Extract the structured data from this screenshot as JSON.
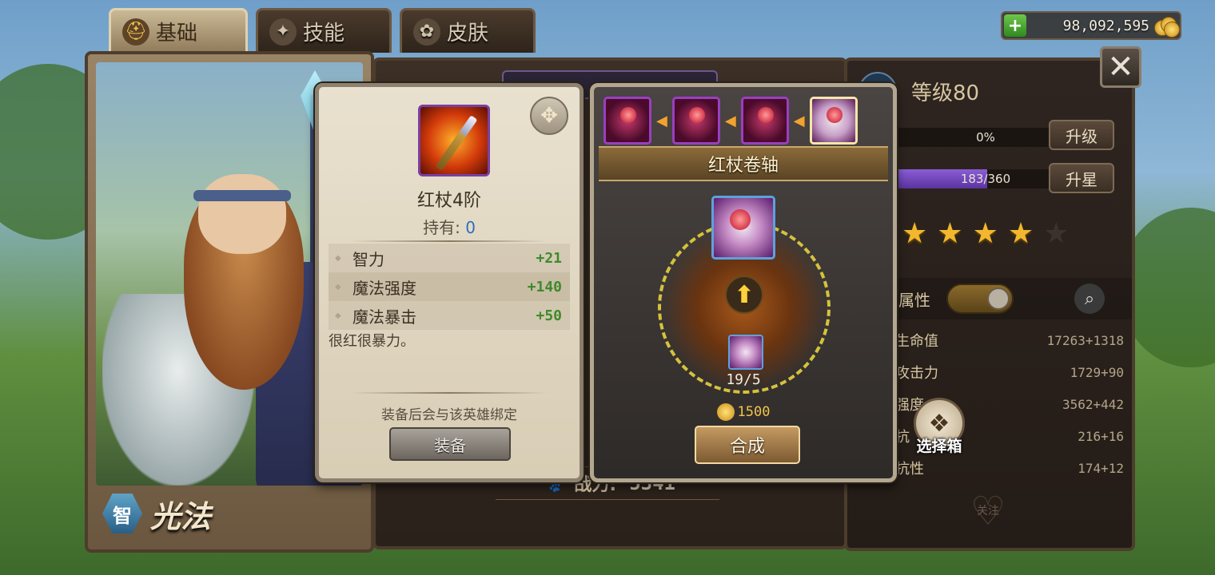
{
  "tabs": [
    {
      "label": "基础",
      "icon": "helmet-icon"
    },
    {
      "label": "技能",
      "icon": "skill-icon"
    },
    {
      "label": "皮肤",
      "icon": "skin-icon"
    }
  ],
  "currency": {
    "gold": "98,092,595"
  },
  "hero": {
    "class_badge": "智",
    "name": "光法"
  },
  "detail": {
    "power_label": "战力:",
    "power_value": "5341"
  },
  "stats": {
    "level_text": "等级80",
    "exp_text": "0%",
    "exp_fraction": 0.0,
    "star_text": "183/360",
    "star_fraction": 0.508,
    "upgrade_label": "升级",
    "star_up_label": "升星",
    "stars_filled": 4,
    "stars_total": 5,
    "attr_title": "属性",
    "rows": [
      {
        "name": "生命值",
        "value": "17263+1318"
      },
      {
        "name": "攻击力",
        "value": "1729+90"
      },
      {
        "name": "强度",
        "value": "3562+442"
      },
      {
        "name": "抗",
        "value": "216+16"
      },
      {
        "name": "抗性",
        "value": "174+12"
      }
    ],
    "follow_label": "关注"
  },
  "chest": {
    "label": "选择箱"
  },
  "item": {
    "name": "红杖4阶",
    "owned_label": "持有:",
    "owned_count": "0",
    "attributes": [
      {
        "name": "智力",
        "bonus": "+21"
      },
      {
        "name": "魔法强度",
        "bonus": "+140"
      },
      {
        "name": "魔法暴击",
        "bonus": "+50"
      }
    ],
    "description": "很红很暴力。",
    "bind_note": "装备后会与该英雄绑定",
    "equip_label": "装备"
  },
  "synthesis": {
    "title": "红杖卷轴",
    "material_count": "19/5",
    "cost": "1500",
    "button_label": "合成"
  },
  "colors": {
    "accent_gold": "#f2c44a",
    "bonus_green": "#3f8a2a",
    "owned_blue": "#2c6fc2"
  }
}
